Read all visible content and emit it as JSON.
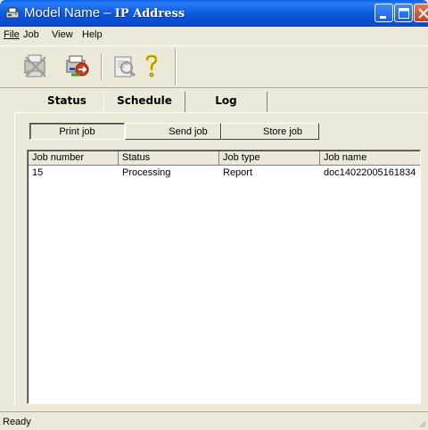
{
  "window": {
    "title_model": "Model Name",
    "title_sep": " – ",
    "title_ip": "IP Address"
  },
  "menu": [
    {
      "label": "File"
    },
    {
      "label": "Job"
    },
    {
      "label": "View"
    },
    {
      "label": "Help"
    }
  ],
  "toolbar": {
    "icons": [
      "delete-job-icon",
      "send-job-icon",
      "preview-icon",
      "help-icon"
    ]
  },
  "tabs": [
    {
      "label": "Status",
      "selected": true
    },
    {
      "label": "Schedule",
      "selected": false
    },
    {
      "label": "Log",
      "selected": false
    }
  ],
  "job_buttons": [
    {
      "label": "Print job",
      "pressed": true
    },
    {
      "label": "Send job",
      "pressed": false
    },
    {
      "label": "Store job",
      "pressed": false
    }
  ],
  "table": {
    "columns": [
      "Job number",
      "Status",
      "Job type",
      "Job name"
    ],
    "rows": [
      [
        "15",
        "Processing",
        "Report",
        "doc14022005161834"
      ]
    ]
  },
  "statusbar": {
    "text": "Ready"
  },
  "colors": {
    "titlebar": "#0a5fe8",
    "chrome": "#ece9d8",
    "close_button": "#e2775a"
  }
}
